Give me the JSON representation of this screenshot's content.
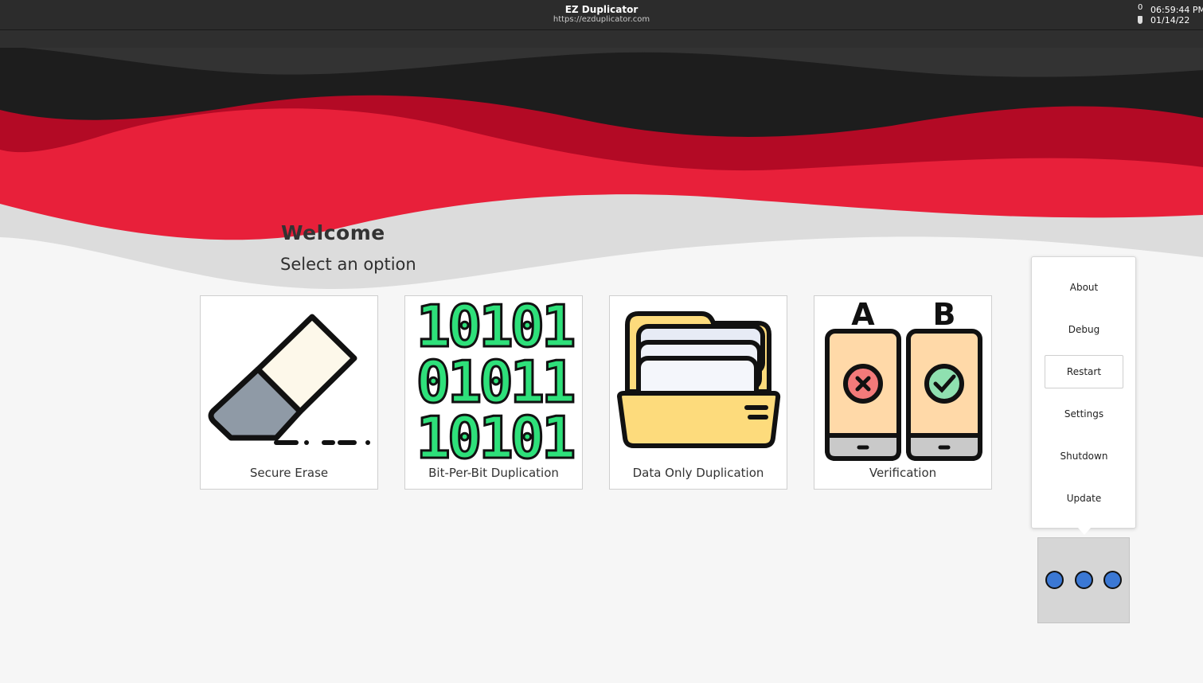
{
  "header": {
    "title": "EZ Duplicator",
    "url": "https://ezduplicator.com",
    "tray": {
      "count": "0",
      "time": "06:59:44 PM",
      "date": "01/14/22",
      "device_icon": "usb-drive-icon"
    }
  },
  "colors": {
    "dark": "#222222",
    "red": "#e8203a",
    "crimson": "#b30a25",
    "accent_blue": "#3b78d4"
  },
  "main": {
    "welcome": "Welcome",
    "subtitle": "Select an option",
    "cards": [
      {
        "label": "Secure Erase",
        "icon": "eraser-icon"
      },
      {
        "label": "Bit-Per-Bit Duplication",
        "icon": "binary-icon"
      },
      {
        "label": "Data Only Duplication",
        "icon": "folder-icon"
      },
      {
        "label": "Verification",
        "icon": "phone-compare-icon"
      }
    ],
    "binary_rows": [
      "10101",
      "01011",
      "10101"
    ],
    "verify_labels": [
      "A",
      "B"
    ]
  },
  "menu": {
    "items": [
      {
        "label": "About"
      },
      {
        "label": "Debug"
      },
      {
        "label": "Restart",
        "active": true
      },
      {
        "label": "Settings"
      },
      {
        "label": "Shutdown"
      },
      {
        "label": "Update"
      }
    ],
    "toggle_icon": "more-dots-icon"
  }
}
